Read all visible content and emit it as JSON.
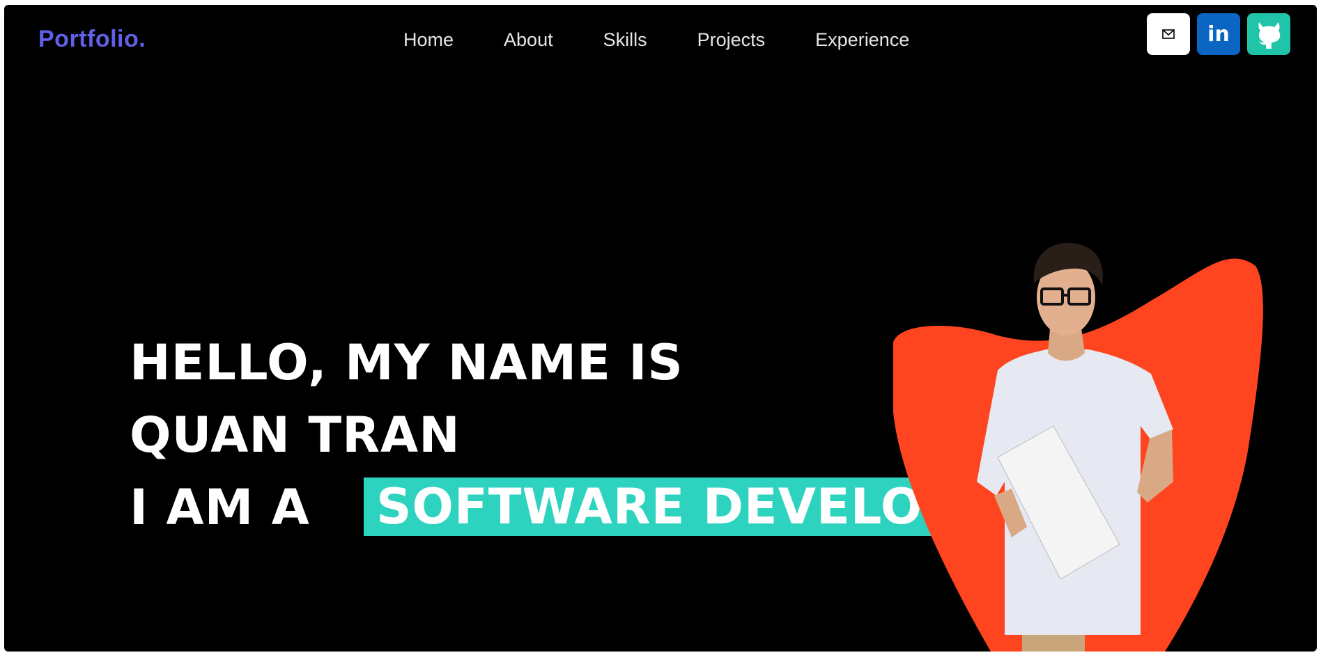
{
  "brand": {
    "logo": "Portfolio."
  },
  "nav": {
    "items": [
      {
        "label": "Home"
      },
      {
        "label": "About"
      },
      {
        "label": "Skills"
      },
      {
        "label": "Projects"
      },
      {
        "label": "Experience"
      }
    ]
  },
  "socials": [
    {
      "icon": "mail-icon",
      "color": "#ffffff"
    },
    {
      "icon": "linkedin-icon",
      "label": "in",
      "color": "#0a66c2"
    },
    {
      "icon": "github-icon",
      "color": "#20c4a8"
    }
  ],
  "hero": {
    "line1": "HELLO, MY NAME IS",
    "line2": "QUAN TRAN",
    "line3_prefix": "I AM A",
    "role": "SOFTWARE DEVELOPER !"
  },
  "colors": {
    "accent": "#2ed3bf",
    "logo": "#6060e8",
    "shape": "#ff4520",
    "background": "#000000"
  }
}
